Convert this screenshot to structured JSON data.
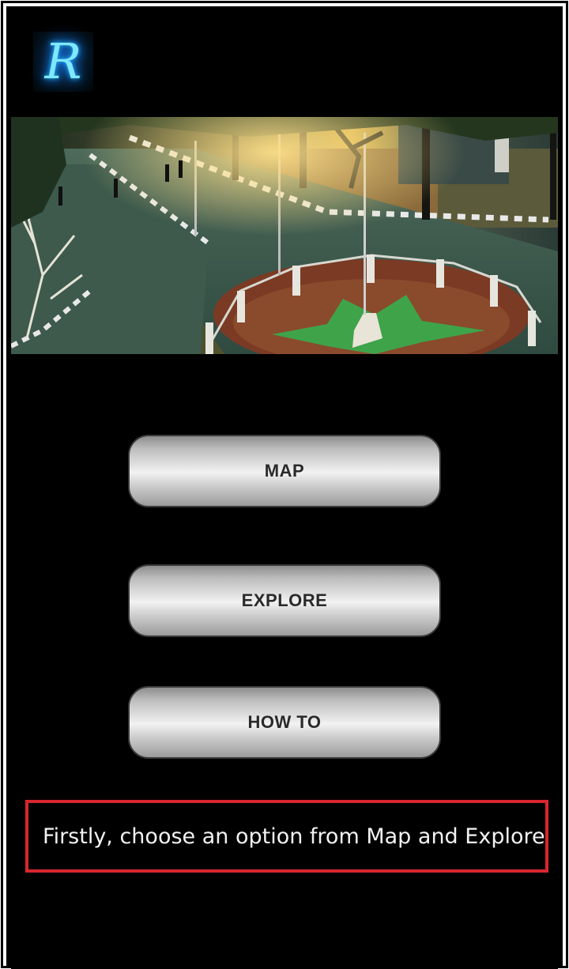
{
  "app": {
    "logo_letter": "R",
    "logo_icon": "r-logo-icon"
  },
  "banner": {
    "image": "campus-aerial-photo"
  },
  "menu": {
    "map_label": "MAP",
    "explore_label": "EXPLORE",
    "howto_label": "HOW TO"
  },
  "hint": {
    "text": "Firstly, choose an option from Map and Explore"
  },
  "colors": {
    "background": "#000000",
    "hint_border": "#d8262f",
    "logo_glow": "#1fb6ff"
  }
}
